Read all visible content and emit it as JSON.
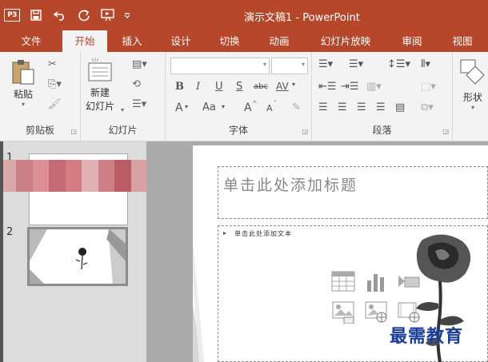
{
  "title_bar": {
    "app_badge": "P3",
    "title": "演示文稿1 - PowerPoint",
    "qat_icons": [
      "save-icon",
      "undo-icon",
      "redo-icon",
      "slideshow-from-start-icon",
      "customize-qat-icon"
    ]
  },
  "tabs": [
    {
      "label": "文件",
      "active": false
    },
    {
      "label": "开始",
      "active": true
    },
    {
      "label": "插入",
      "active": false
    },
    {
      "label": "设计",
      "active": false
    },
    {
      "label": "切换",
      "active": false
    },
    {
      "label": "动画",
      "active": false
    },
    {
      "label": "幻灯片放映",
      "active": false
    },
    {
      "label": "审阅",
      "active": false
    },
    {
      "label": "视图",
      "active": false
    }
  ],
  "ribbon": {
    "clipboard": {
      "label": "剪贴板",
      "paste": "粘贴"
    },
    "slides": {
      "label": "幻灯片",
      "new_slide_line1": "新建",
      "new_slide_line2": "幻灯片"
    },
    "font": {
      "label": "字体",
      "bold": "B",
      "italic": "I",
      "underline": "U",
      "shadow": "S",
      "strike": "abc",
      "spacing": "AV",
      "font_color": "A",
      "change_case": "Aa",
      "grow": "A",
      "shrink": "A"
    },
    "paragraph": {
      "label": "段落"
    },
    "drawing": {
      "shapes": "形状"
    }
  },
  "thumbnails": [
    {
      "number": "1"
    },
    {
      "number": "2"
    }
  ],
  "slide": {
    "title_placeholder": "单击此处添加标题",
    "body_placeholder": "单击此处添加文本",
    "bullet": "▸"
  },
  "watermark": "最需教育",
  "colors": {
    "accent": "#b7472a",
    "ribbon_bg": "#f3f3f3",
    "workspace": "#ababab",
    "thumb_panel": "#dcdcdc",
    "watermark": "#1c3c9a"
  }
}
